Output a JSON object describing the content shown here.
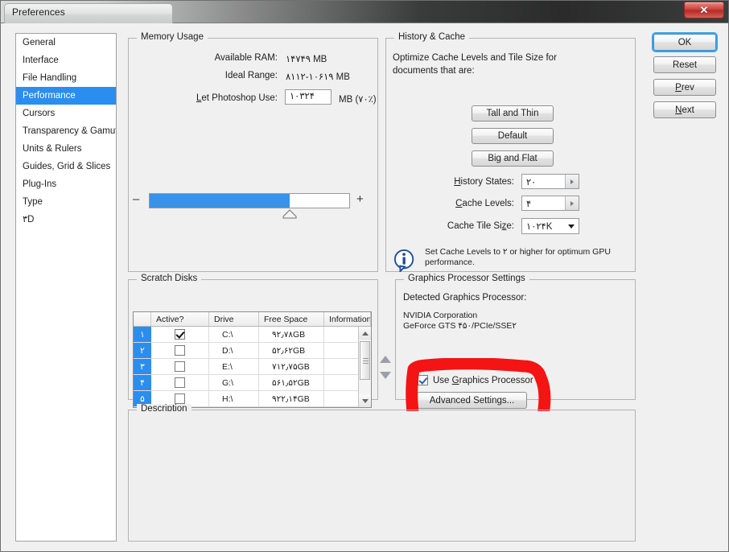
{
  "window": {
    "title": "Preferences",
    "close_label": "✕",
    "close_icon": "close-icon"
  },
  "sidebar": {
    "items": [
      {
        "label": "General",
        "selected": false
      },
      {
        "label": "Interface",
        "selected": false
      },
      {
        "label": "File Handling",
        "selected": false
      },
      {
        "label": "Performance",
        "selected": true
      },
      {
        "label": "Cursors",
        "selected": false
      },
      {
        "label": "Transparency & Gamut",
        "selected": false
      },
      {
        "label": "Units & Rulers",
        "selected": false
      },
      {
        "label": "Guides, Grid & Slices",
        "selected": false
      },
      {
        "label": "Plug-Ins",
        "selected": false
      },
      {
        "label": "Type",
        "selected": false
      },
      {
        "label": "۳D",
        "selected": false
      }
    ]
  },
  "memory_usage": {
    "legend": "Memory Usage",
    "available_ram_label": "Available RAM:",
    "available_ram_value": "۱۴۷۴۹ MB",
    "ideal_range_label": "Ideal Range:",
    "ideal_range_value": "۸۱۱۲-۱۰۶۱۹ MB",
    "let_photoshop_use_label": "Let Photoshop Use:",
    "let_photoshop_use_value": "۱۰۳۲۴",
    "unit_suffix": "MB (۷۰٪)",
    "slider_percent": 70,
    "slider_minus": "–",
    "slider_plus": "+",
    "slider_fill_color": "#3a92e8"
  },
  "history_cache": {
    "legend": "History & Cache",
    "optimize_text_line1": "Optimize Cache Levels and Tile Size for",
    "optimize_text_line2": "documents that are:",
    "preset_buttons": [
      {
        "label": "Tall and Thin"
      },
      {
        "label": "Default"
      },
      {
        "label": "Big and Flat"
      }
    ],
    "history_states_label": "History States:",
    "history_states_value": "۲۰",
    "cache_levels_label": "Cache Levels:",
    "cache_levels_value": "۴",
    "cache_tile_size_label": "Cache Tile Size:",
    "cache_tile_size_value": "۱۰۲۴K",
    "info_icon": "info-icon",
    "info_line1": "Set Cache Levels to ۲ or higher for optimum GPU",
    "info_line2": "performance."
  },
  "scratch_disks": {
    "legend": "Scratch Disks",
    "columns": [
      "",
      "Active?",
      "Drive",
      "Free Space",
      "Information"
    ],
    "rows": [
      {
        "num": "۱",
        "active": true,
        "drive": "C:\\",
        "free": "۹۲٫۷۸GB",
        "info": ""
      },
      {
        "num": "۲",
        "active": false,
        "drive": "D:\\",
        "free": "۵۲٫۶۲GB",
        "info": ""
      },
      {
        "num": "۳",
        "active": false,
        "drive": "E:\\",
        "free": "۷۱۲٫۷۵GB",
        "info": ""
      },
      {
        "num": "۴",
        "active": false,
        "drive": "G:\\",
        "free": "۵۶۱٫۵۲GB",
        "info": ""
      },
      {
        "num": "۵",
        "active": false,
        "drive": "H:\\",
        "free": "۹۲۲٫۱۴GB",
        "info": ""
      }
    ],
    "reorder_up_icon": "arrow-up-icon",
    "reorder_down_icon": "arrow-down-icon"
  },
  "graphics_processor": {
    "legend": "Graphics Processor Settings",
    "detected_label": "Detected Graphics Processor:",
    "vendor": "NVIDIA Corporation",
    "model": "GeForce GTS ۴۵۰/PCIe/SSE۲",
    "use_gpu_label": "Use Graphics Processor",
    "use_gpu_checked": true,
    "advanced_settings_label": "Advanced Settings...",
    "annotation_color": "#f41414"
  },
  "description": {
    "legend": "Description",
    "text": ""
  },
  "actions": {
    "ok_label": "OK",
    "reset_label": "Reset",
    "prev_label": "Prev",
    "next_label": "Next"
  }
}
